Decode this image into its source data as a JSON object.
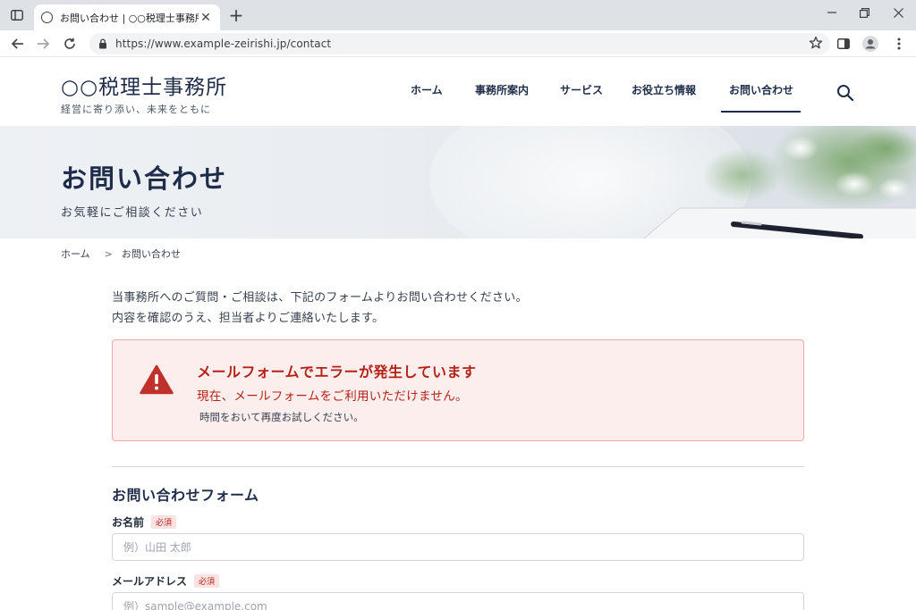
{
  "browser": {
    "tab_title": "お問い合わせ | ○○税理士事務所",
    "tab_close": "✕",
    "new_tab": "+",
    "url": "https://www.example-zeirishi.jp/contact"
  },
  "site": {
    "logo": "○○税理士事務所",
    "tagline": "経営に寄り添い、未来をともに",
    "nav": [
      {
        "label": "ホーム"
      },
      {
        "label": "事務所案内"
      },
      {
        "label": "サービス"
      },
      {
        "label": "お役立ち情報"
      },
      {
        "label": "お問い合わせ",
        "active": true
      }
    ]
  },
  "hero": {
    "title": "お問い合わせ",
    "subtitle": "お気軽にご相談ください"
  },
  "breadcrumb": {
    "items": [
      "ホーム",
      "お問い合わせ"
    ],
    "separator": ">"
  },
  "intro": {
    "line1": "当事務所へのご質問・ご相談は、下記のフォームよりお問い合わせください。",
    "line2": "内容を確認のうえ、担当者よりご連絡いたします。"
  },
  "alert": {
    "title": "メールフォームでエラーが発生しています",
    "message": "現在、メールフォームをご利用いただけません。",
    "note": "時間をおいて再度お試しください。",
    "color": "#b42318"
  },
  "form": {
    "title": "お問い合わせフォーム",
    "required_badge": "必須",
    "fields": [
      {
        "label": "お名前",
        "placeholder": "例）山田 太郎"
      },
      {
        "label": "メールアドレス",
        "placeholder": "例）sample@example.com"
      }
    ]
  },
  "colors": {
    "brand_navy": "#1f2d4a",
    "error_red": "#b42318",
    "error_bg": "#fdeeee"
  }
}
